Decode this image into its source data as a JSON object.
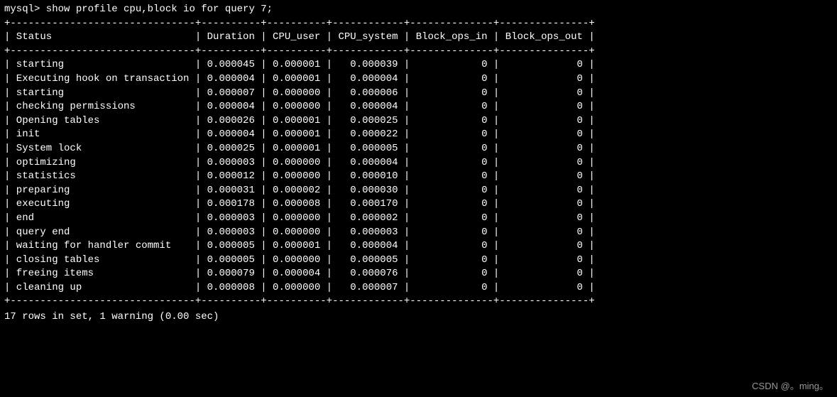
{
  "prompt": "mysql> show profile cpu,block io for query 7;",
  "border": "+-------------------------------+----------+----------+------------+--------------+---------------+",
  "columns": [
    "Status",
    "Duration",
    "CPU_user",
    "CPU_system",
    "Block_ops_in",
    "Block_ops_out"
  ],
  "rows": [
    {
      "status": "starting",
      "duration": "0.000045",
      "cpu_user": "0.000001",
      "cpu_system": "0.000039",
      "block_ops_in": "0",
      "block_ops_out": "0"
    },
    {
      "status": "Executing hook on transaction",
      "duration": "0.000004",
      "cpu_user": "0.000001",
      "cpu_system": "0.000004",
      "block_ops_in": "0",
      "block_ops_out": "0"
    },
    {
      "status": "starting",
      "duration": "0.000007",
      "cpu_user": "0.000000",
      "cpu_system": "0.000006",
      "block_ops_in": "0",
      "block_ops_out": "0"
    },
    {
      "status": "checking permissions",
      "duration": "0.000004",
      "cpu_user": "0.000000",
      "cpu_system": "0.000004",
      "block_ops_in": "0",
      "block_ops_out": "0"
    },
    {
      "status": "Opening tables",
      "duration": "0.000026",
      "cpu_user": "0.000001",
      "cpu_system": "0.000025",
      "block_ops_in": "0",
      "block_ops_out": "0"
    },
    {
      "status": "init",
      "duration": "0.000004",
      "cpu_user": "0.000001",
      "cpu_system": "0.000022",
      "block_ops_in": "0",
      "block_ops_out": "0"
    },
    {
      "status": "System lock",
      "duration": "0.000025",
      "cpu_user": "0.000001",
      "cpu_system": "0.000005",
      "block_ops_in": "0",
      "block_ops_out": "0"
    },
    {
      "status": "optimizing",
      "duration": "0.000003",
      "cpu_user": "0.000000",
      "cpu_system": "0.000004",
      "block_ops_in": "0",
      "block_ops_out": "0"
    },
    {
      "status": "statistics",
      "duration": "0.000012",
      "cpu_user": "0.000000",
      "cpu_system": "0.000010",
      "block_ops_in": "0",
      "block_ops_out": "0"
    },
    {
      "status": "preparing",
      "duration": "0.000031",
      "cpu_user": "0.000002",
      "cpu_system": "0.000030",
      "block_ops_in": "0",
      "block_ops_out": "0"
    },
    {
      "status": "executing",
      "duration": "0.000178",
      "cpu_user": "0.000008",
      "cpu_system": "0.000170",
      "block_ops_in": "0",
      "block_ops_out": "0"
    },
    {
      "status": "end",
      "duration": "0.000003",
      "cpu_user": "0.000000",
      "cpu_system": "0.000002",
      "block_ops_in": "0",
      "block_ops_out": "0"
    },
    {
      "status": "query end",
      "duration": "0.000003",
      "cpu_user": "0.000000",
      "cpu_system": "0.000003",
      "block_ops_in": "0",
      "block_ops_out": "0"
    },
    {
      "status": "waiting for handler commit",
      "duration": "0.000005",
      "cpu_user": "0.000001",
      "cpu_system": "0.000004",
      "block_ops_in": "0",
      "block_ops_out": "0"
    },
    {
      "status": "closing tables",
      "duration": "0.000005",
      "cpu_user": "0.000000",
      "cpu_system": "0.000005",
      "block_ops_in": "0",
      "block_ops_out": "0"
    },
    {
      "status": "freeing items",
      "duration": "0.000079",
      "cpu_user": "0.000004",
      "cpu_system": "0.000076",
      "block_ops_in": "0",
      "block_ops_out": "0"
    },
    {
      "status": "cleaning up",
      "duration": "0.000008",
      "cpu_user": "0.000000",
      "cpu_system": "0.000007",
      "block_ops_in": "0",
      "block_ops_out": "0"
    }
  ],
  "summary": "17 rows in set, 1 warning (0.00 sec)",
  "watermark": "CSDN @。ming。"
}
